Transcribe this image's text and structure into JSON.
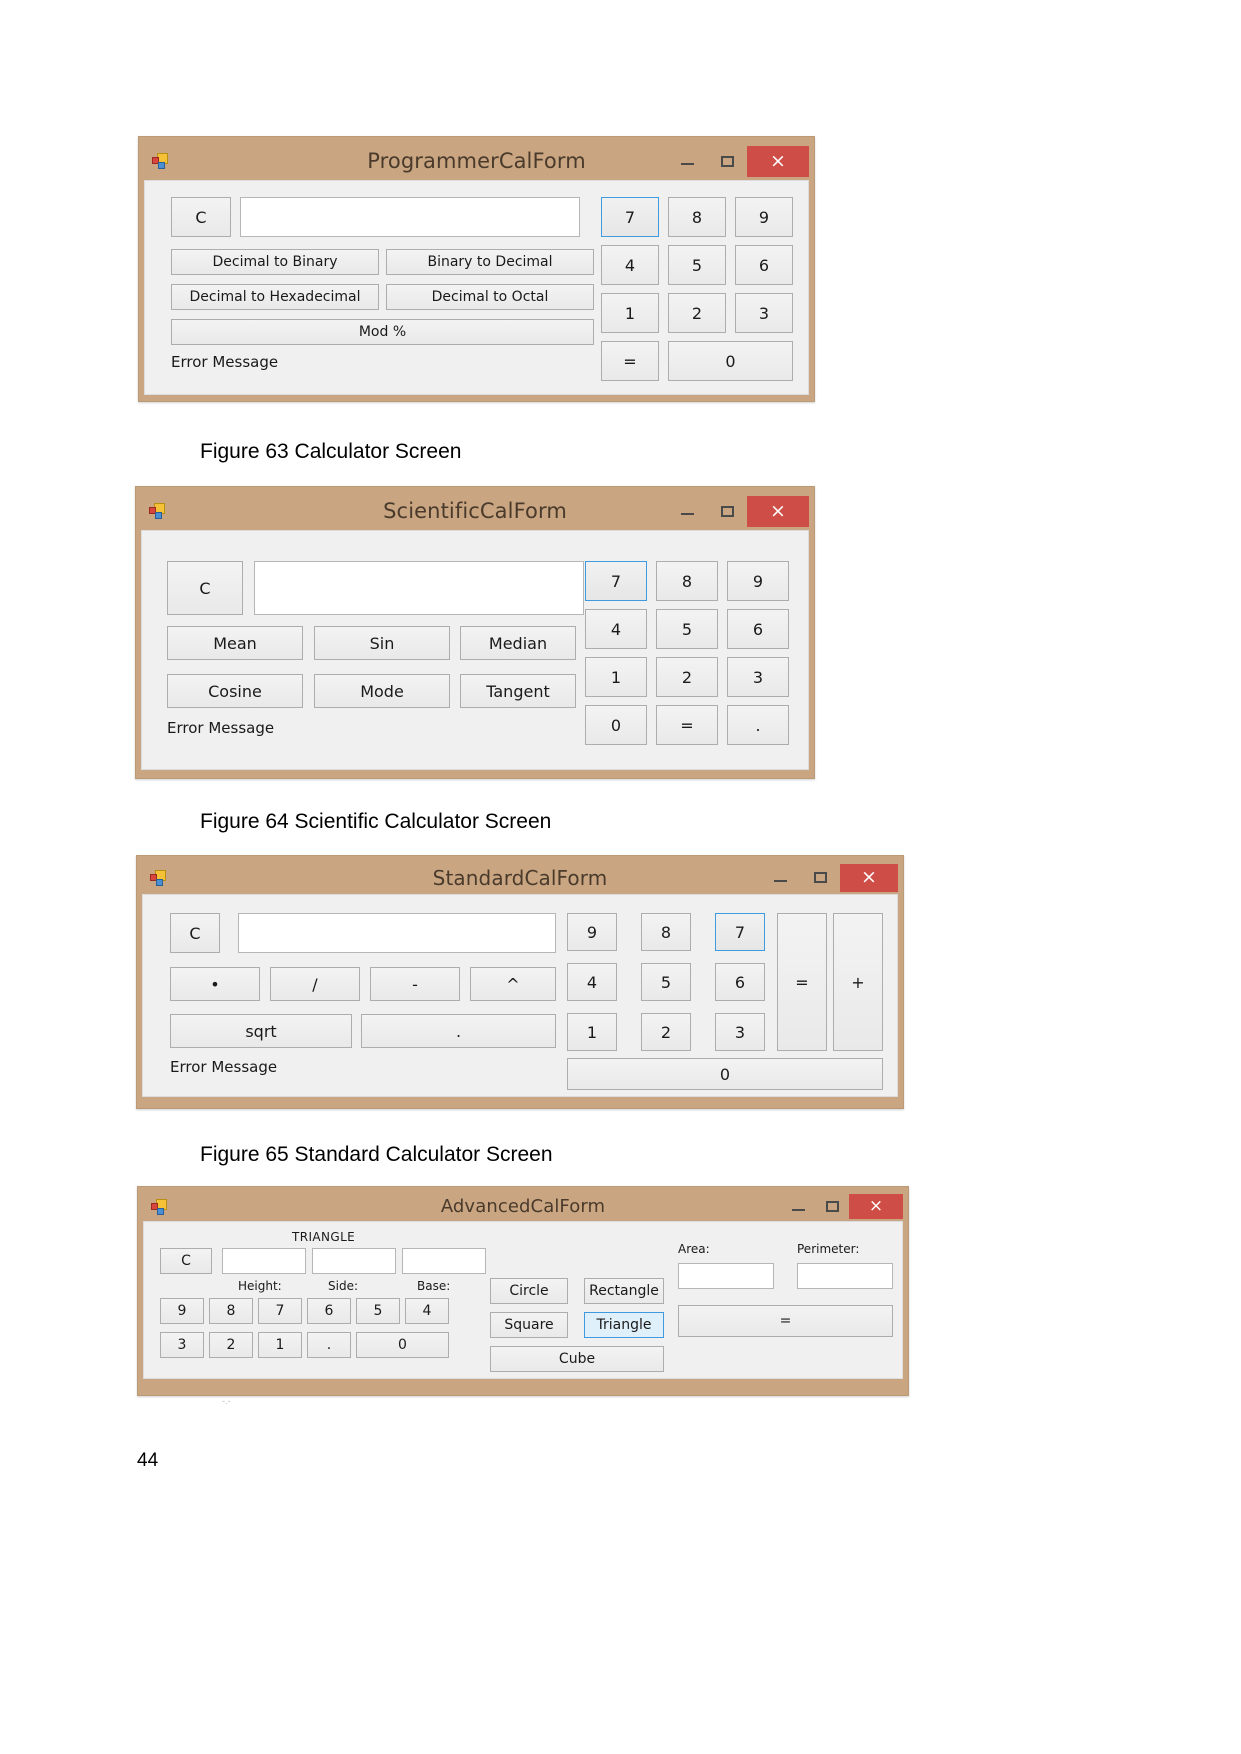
{
  "page": {
    "number": "44",
    "artifact": "-.-"
  },
  "captions": {
    "fig63": "Figure 63 Calculator Screen",
    "fig64": "Figure 64 Scientific Calculator Screen",
    "fig65": "Figure 65 Standard Calculator Screen"
  },
  "window_controls": {
    "minimize": "–",
    "maximize": "□",
    "close": "×"
  },
  "colors": {
    "titlebar": "#c9a681",
    "close_button": "#cf4d47",
    "body": "#f0f0f0",
    "selected_border": "#3f9ae0"
  },
  "programmer": {
    "title": "ProgrammerCalForm",
    "clear_label": "C",
    "display_value": "",
    "conversions": [
      "Decimal to Binary",
      "Binary to Decimal",
      "Decimal to Hexadecimal",
      "Decimal to Octal"
    ],
    "mod_label": "Mod %",
    "error_label": "Error Message",
    "keys": [
      "7",
      "8",
      "9",
      "4",
      "5",
      "6",
      "1",
      "2",
      "3"
    ],
    "equals_label": "=",
    "zero_label": "0",
    "selected_key": "7"
  },
  "scientific": {
    "title": "ScientificCalForm",
    "clear_label": "C",
    "display_value": "",
    "functions": [
      "Mean",
      "Sin",
      "Median",
      "Cosine",
      "Mode",
      "Tangent"
    ],
    "error_label": "Error Message",
    "keys": [
      "7",
      "8",
      "9",
      "4",
      "5",
      "6",
      "1",
      "2",
      "3",
      "0",
      "=",
      "."
    ],
    "selected_key": "7"
  },
  "standard": {
    "title": "StandardCalForm",
    "clear_label": "C",
    "display_value": "",
    "operators": [
      "•",
      "/",
      "-",
      "^"
    ],
    "sqrt_label": "sqrt",
    "dot_label": ".",
    "error_label": "Error Message",
    "keys": [
      "9",
      "8",
      "7",
      "4",
      "5",
      "6",
      "1",
      "2",
      "3"
    ],
    "equals_label": "=",
    "plus_label": "+",
    "zero_label": "0",
    "selected_key": "7"
  },
  "advanced": {
    "title": "AdvancedCalForm",
    "section_label": "TRIANGLE",
    "clear_label": "C",
    "inputs": [
      "",
      "",
      ""
    ],
    "input_labels": [
      "Height:",
      "Side:",
      "Base:"
    ],
    "keys_row1": [
      "9",
      "8",
      "7",
      "6",
      "5",
      "4"
    ],
    "keys_row2": [
      "3",
      "2",
      "1",
      ".",
      "0"
    ],
    "shapes": [
      "Circle",
      "Rectangle",
      "Square",
      "Triangle",
      "Cube"
    ],
    "selected_shape": "Triangle",
    "area_label": "Area:",
    "perimeter_label": "Perimeter:",
    "area_value": "",
    "perimeter_value": "",
    "equals_label": "="
  }
}
